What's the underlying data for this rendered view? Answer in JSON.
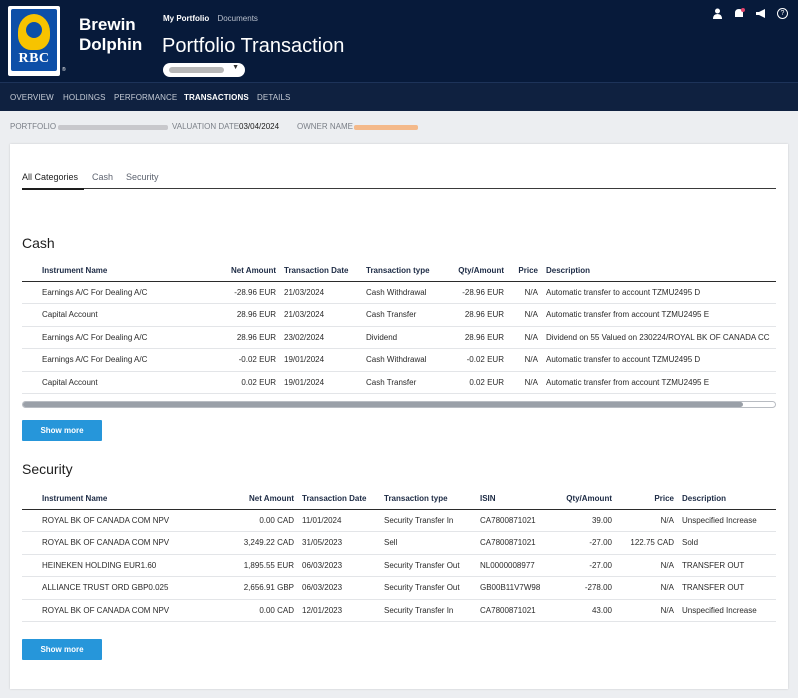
{
  "brand": {
    "line1": "Brewin",
    "line2": "Dolphin",
    "logo_text": "RBC",
    "reg": "®"
  },
  "top_nav": {
    "portfolio": "My Portfolio",
    "documents": "Documents"
  },
  "page_title": "Portfolio Transaction",
  "header_icons": [
    "user-icon",
    "notification-bell-icon",
    "megaphone-icon",
    "help-icon"
  ],
  "subnav": [
    "OVERVIEW",
    "HOLDINGS",
    "PERFORMANCE",
    "TRANSACTIONS",
    "DETAILS"
  ],
  "info": {
    "portfolio_label": "PORTFOLIO",
    "valuation_label": "VALUATION DATE",
    "valuation_date": "03/04/2024",
    "owner_label": "OWNER NAME"
  },
  "tabs": [
    "All Categories",
    "Cash",
    "Security"
  ],
  "cash": {
    "title": "Cash",
    "headers": [
      "Instrument Name",
      "Net Amount",
      "Transaction Date",
      "Transaction type",
      "Qty/Amount",
      "Price",
      "Description"
    ],
    "rows": [
      [
        "Earnings A/C For Dealing A/C",
        "-28.96 EUR",
        "21/03/2024",
        "Cash Withdrawal",
        "-28.96 EUR",
        "N/A",
        "Automatic transfer to account TZMU2495 D"
      ],
      [
        "Capital Account",
        "28.96 EUR",
        "21/03/2024",
        "Cash Transfer",
        "28.96 EUR",
        "N/A",
        "Automatic transfer from account TZMU2495 E"
      ],
      [
        "Earnings A/C For Dealing A/C",
        "28.96 EUR",
        "23/02/2024",
        "Dividend",
        "28.96 EUR",
        "N/A",
        "Dividend on 55 Valued on 230224/ROYAL BK OF CANADA CC"
      ],
      [
        "Earnings A/C For Dealing A/C",
        "-0.02 EUR",
        "19/01/2024",
        "Cash Withdrawal",
        "-0.02 EUR",
        "N/A",
        "Automatic transfer to account TZMU2495 D"
      ],
      [
        "Capital Account",
        "0.02 EUR",
        "19/01/2024",
        "Cash Transfer",
        "0.02 EUR",
        "N/A",
        "Automatic transfer from account TZMU2495 E"
      ]
    ],
    "show_more": "Show more"
  },
  "security": {
    "title": "Security",
    "headers": [
      "Instrument Name",
      "Net Amount",
      "Transaction Date",
      "Transaction type",
      "ISIN",
      "Qty/Amount",
      "Price",
      "Description"
    ],
    "rows": [
      [
        "ROYAL BK OF CANADA COM NPV",
        "0.00 CAD",
        "11/01/2024",
        "Security Transfer In",
        "CA7800871021",
        "39.00",
        "N/A",
        "Unspecified Increase"
      ],
      [
        "ROYAL BK OF CANADA COM NPV",
        "3,249.22 CAD",
        "31/05/2023",
        "Sell",
        "CA7800871021",
        "-27.00",
        "122.75 CAD",
        "Sold"
      ],
      [
        "HEINEKEN HOLDING EUR1.60",
        "1,895.55 EUR",
        "06/03/2023",
        "Security Transfer Out",
        "NL0000008977",
        "-27.00",
        "N/A",
        "TRANSFER OUT"
      ],
      [
        "ALLIANCE TRUST ORD GBP0.025",
        "2,656.91 GBP",
        "06/03/2023",
        "Security Transfer Out",
        "GB00B11V7W98",
        "-278.00",
        "N/A",
        "TRANSFER OUT"
      ],
      [
        "ROYAL BK OF CANADA COM NPV",
        "0.00 CAD",
        "12/01/2023",
        "Security Transfer In",
        "CA7800871021",
        "43.00",
        "N/A",
        "Unspecified Increase"
      ]
    ],
    "show_more": "Show more"
  },
  "colors": {
    "header_bg": "#071a3a",
    "button": "#2696da",
    "mask_orange": "#f4b98a"
  }
}
